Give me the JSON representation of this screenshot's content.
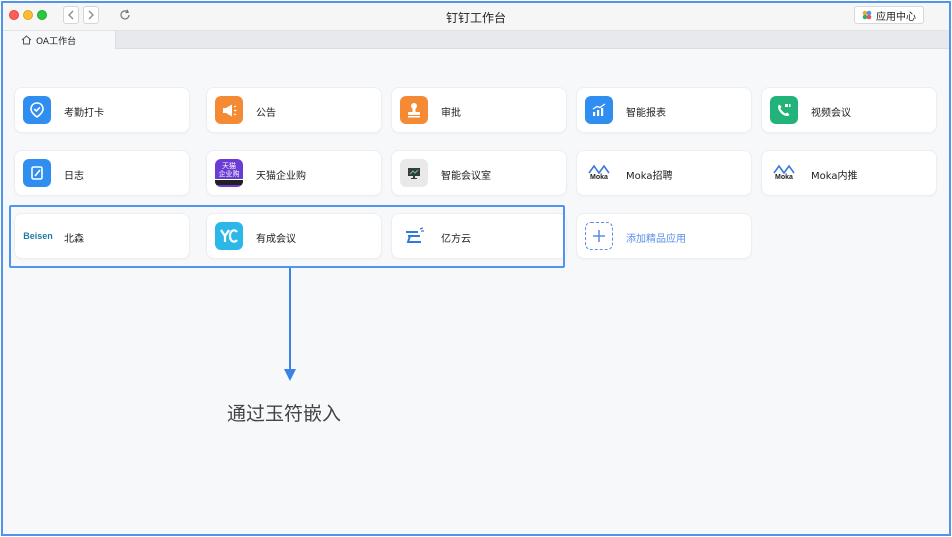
{
  "window": {
    "title": "钉钉工作台",
    "app_center_label": "应用中心"
  },
  "tabs": [
    {
      "label": "OA工作台"
    }
  ],
  "apps": [
    {
      "label": "考勤打卡",
      "icon": "attendance-icon",
      "color": "#2f8ef0"
    },
    {
      "label": "公告",
      "icon": "megaphone-icon",
      "color": "#f58a35"
    },
    {
      "label": "审批",
      "icon": "stamp-icon",
      "color": "#f58a35"
    },
    {
      "label": "智能报表",
      "icon": "chart-icon",
      "color": "#2f8ef0"
    },
    {
      "label": "视频会议",
      "icon": "video-call-icon",
      "color": "#22b37a"
    },
    {
      "label": "日志",
      "icon": "journal-icon",
      "color": "#2f8ef0"
    },
    {
      "label": "天猫企业购",
      "icon": "tmall-icon",
      "color": "#6a3cd4",
      "icon_text": [
        "天猫",
        "企业购"
      ]
    },
    {
      "label": "智能会议室",
      "icon": "meeting-room-icon",
      "color": "#e6e6e6"
    },
    {
      "label": "Moka招聘",
      "icon": "moka-icon",
      "color": "#ffffff",
      "icon_text": [
        "Moka"
      ]
    },
    {
      "label": "Moka内推",
      "icon": "moka-icon",
      "color": "#ffffff",
      "icon_text": [
        "Moka"
      ]
    },
    {
      "label": "北森",
      "icon": "beisen-icon",
      "color": "#ffffff",
      "icon_text": [
        "Beisen"
      ]
    },
    {
      "label": "有成会议",
      "icon": "youcheng-icon",
      "color": "#2bb8e8"
    },
    {
      "label": "亿方云",
      "icon": "yifangyun-icon",
      "color": "#ffffff"
    },
    {
      "label": "添加精品应用",
      "icon": "add-icon",
      "color": "#5a8ee6"
    }
  ],
  "annotation": {
    "text": "通过玉符嵌入"
  },
  "colors": {
    "accent": "#4f95f0",
    "arrow": "#3b82e6"
  }
}
